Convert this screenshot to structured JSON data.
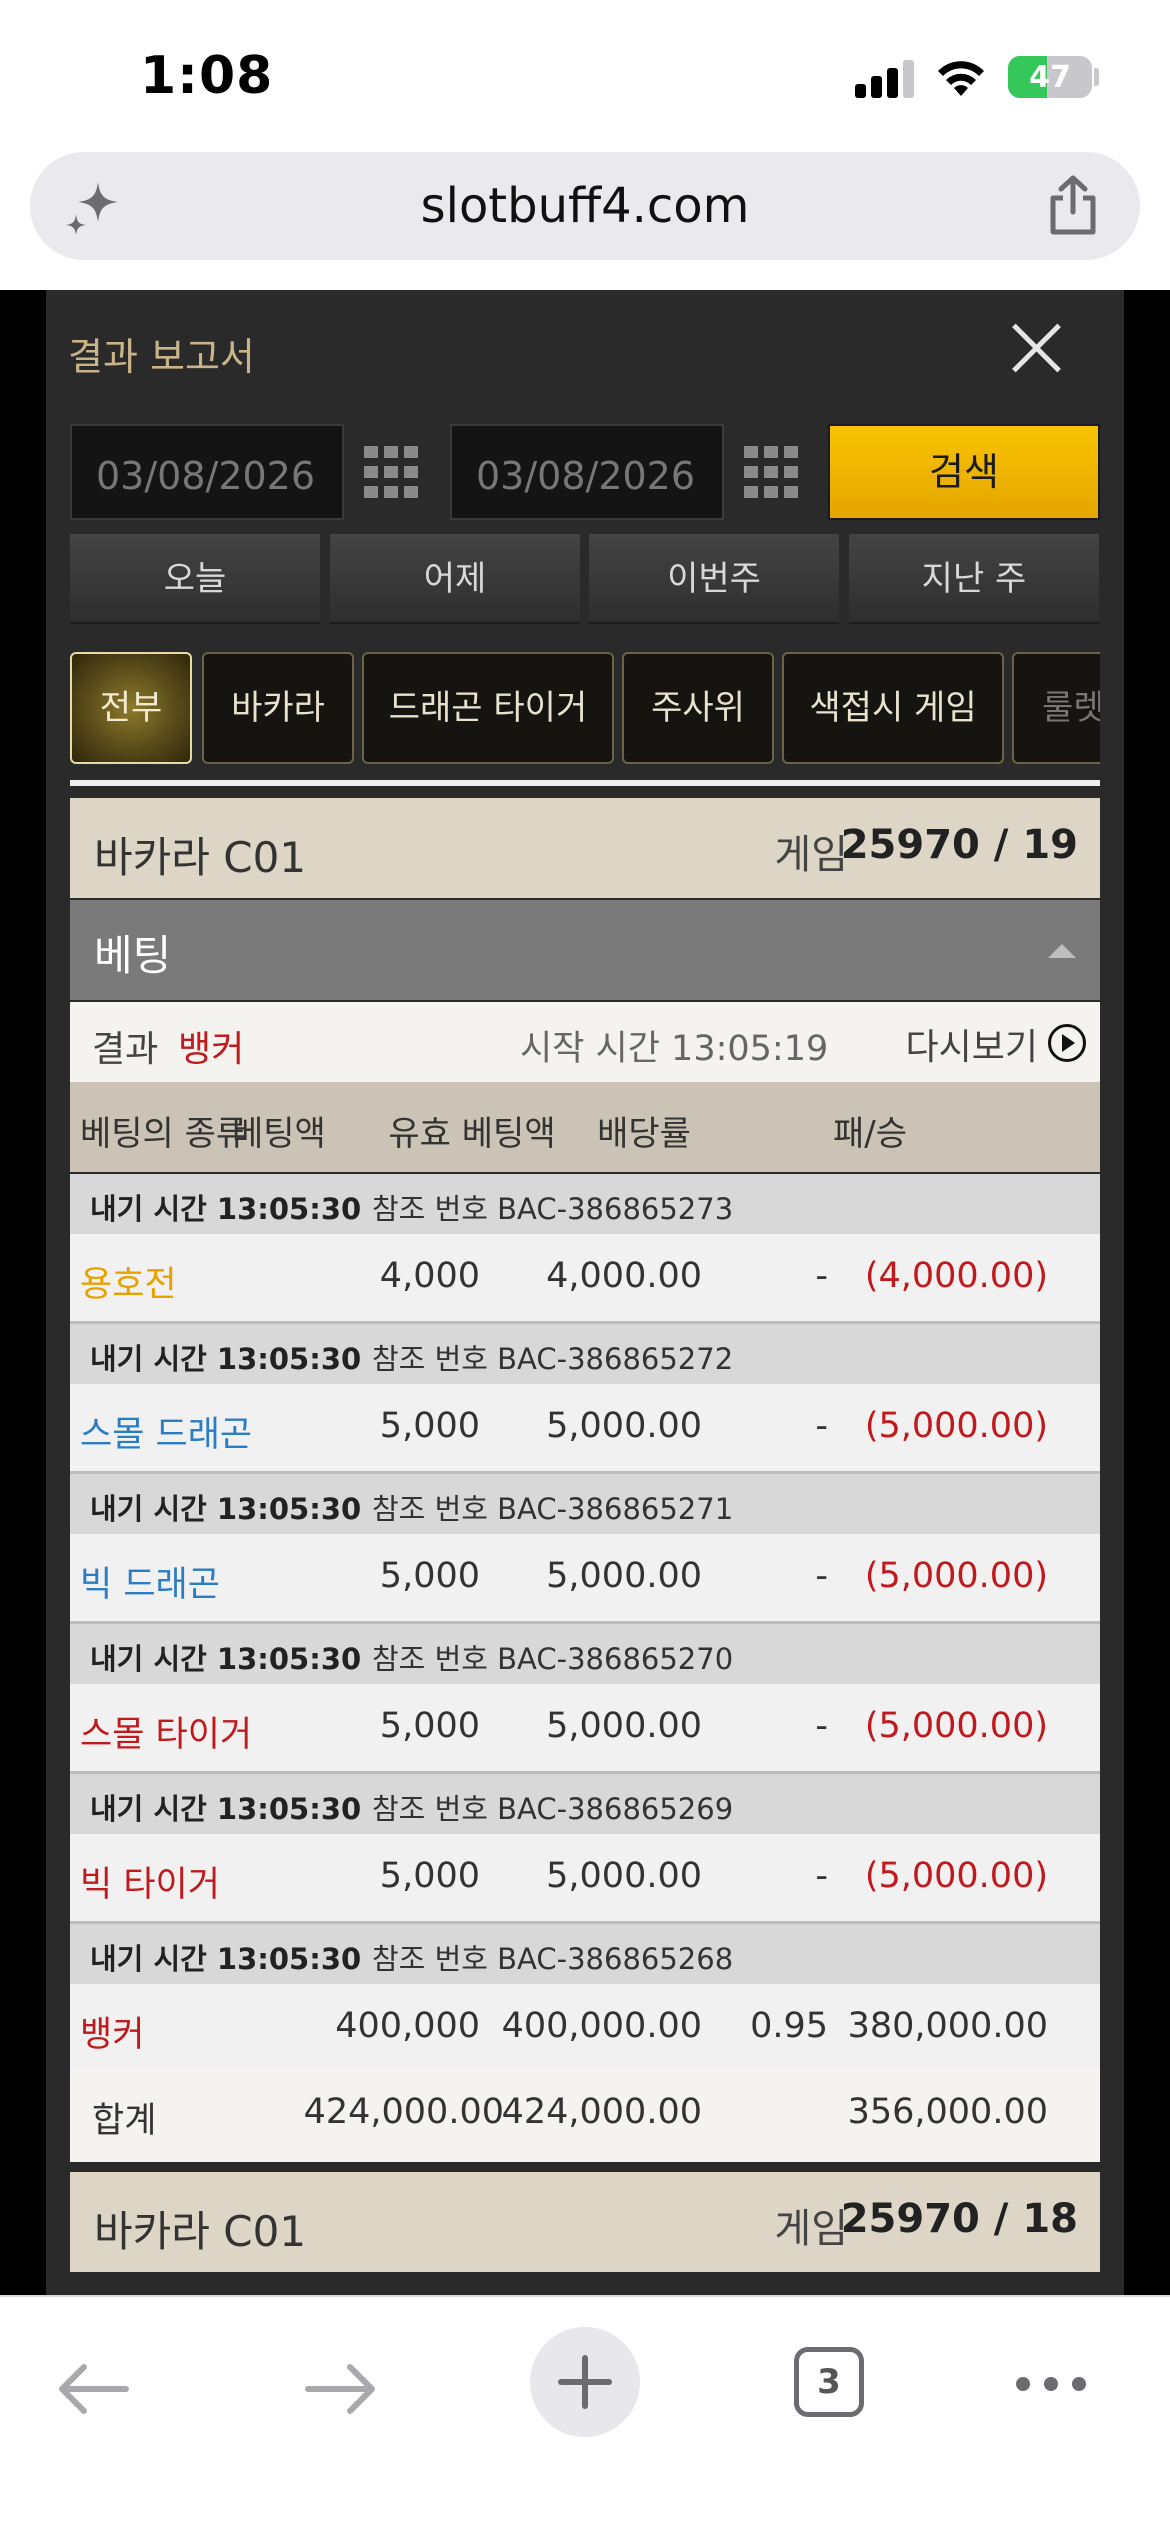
{
  "status_bar": {
    "time": "1:08",
    "battery": "47",
    "battery_level": 0.47
  },
  "browser": {
    "url": "slotbuff4.com",
    "tab_count": "3"
  },
  "modal": {
    "title": "결과 보고서",
    "date_from": "03/08/2026",
    "date_to": "03/08/2026",
    "search_label": "검색",
    "quick_ranges": [
      "오늘",
      "어제",
      "이번주",
      "지난 주"
    ],
    "filters": [
      "전부",
      "바카라",
      "드래곤 타이거",
      "주사위",
      "색접시 게임",
      "룰렛"
    ],
    "active_filter": "전부"
  },
  "game_block": {
    "game_name": "바카라 C01",
    "game_label": "게임",
    "game_number": "25970 / 19",
    "section_label": "베팅",
    "result_label": "결과",
    "result_value": "뱅커",
    "start_time": "시작 시간 13:05:19",
    "replay_label": "다시보기",
    "columns": [
      "베팅의 종류",
      "베팅액",
      "유효 베팅액",
      "배당률",
      "패/승"
    ],
    "bets": [
      {
        "time": "내기 시간 13:05:30",
        "ref": "참조 번호 BAC-386865273",
        "type": "용호전",
        "type_color": "#e8a200",
        "amount": "4,000",
        "valid": "4,000.00",
        "odds": "-",
        "result": "(4,000.00)",
        "result_color": "#c0191e"
      },
      {
        "time": "내기 시간 13:05:30",
        "ref": "참조 번호 BAC-386865272",
        "type": "스몰 드래곤",
        "type_color": "#2a7dc4",
        "amount": "5,000",
        "valid": "5,000.00",
        "odds": "-",
        "result": "(5,000.00)",
        "result_color": "#c0191e"
      },
      {
        "time": "내기 시간 13:05:30",
        "ref": "참조 번호 BAC-386865271",
        "type": "빅 드래곤",
        "type_color": "#2a7dc4",
        "amount": "5,000",
        "valid": "5,000.00",
        "odds": "-",
        "result": "(5,000.00)",
        "result_color": "#c0191e"
      },
      {
        "time": "내기 시간 13:05:30",
        "ref": "참조 번호 BAC-386865270",
        "type": "스몰 타이거",
        "type_color": "#c0191e",
        "amount": "5,000",
        "valid": "5,000.00",
        "odds": "-",
        "result": "(5,000.00)",
        "result_color": "#c0191e"
      },
      {
        "time": "내기 시간 13:05:30",
        "ref": "참조 번호 BAC-386865269",
        "type": "빅 타이거",
        "type_color": "#c0191e",
        "amount": "5,000",
        "valid": "5,000.00",
        "odds": "-",
        "result": "(5,000.00)",
        "result_color": "#c0191e"
      },
      {
        "time": "내기 시간 13:05:30",
        "ref": "참조 번호 BAC-386865268",
        "type": "뱅커",
        "type_color": "#c0191e",
        "amount": "400,000",
        "valid": "400,000.00",
        "odds": "0.95",
        "result": "380,000.00",
        "result_color": "#333333"
      }
    ],
    "total": {
      "label": "합계",
      "amount": "424,000.00",
      "valid": "424,000.00",
      "result": "356,000.00"
    }
  },
  "next_game": {
    "game_name": "바카라 C01",
    "game_label": "게임",
    "game_number": "25970 / 18"
  }
}
